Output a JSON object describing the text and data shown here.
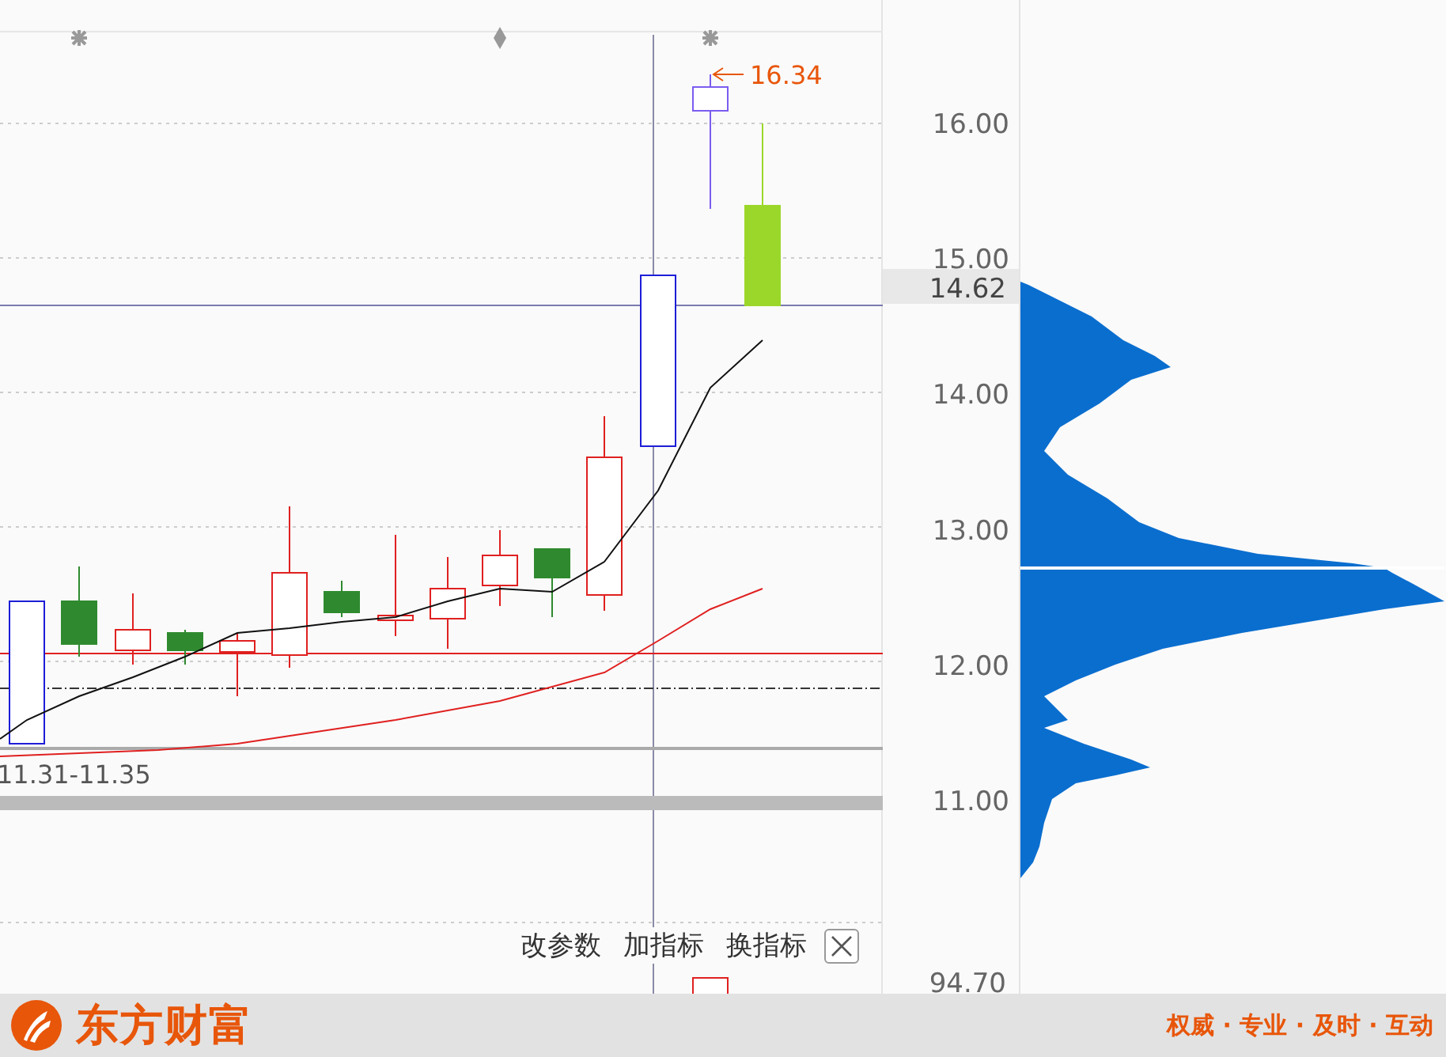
{
  "chart": {
    "high_label": "16.34",
    "range_label": "11.31-11.35"
  },
  "price_axis": {
    "labels": [
      "16.00",
      "15.00",
      "14.00",
      "13.00",
      "12.00",
      "11.00"
    ],
    "current_price": "14.62",
    "sub_label": "94.70"
  },
  "toolbar": {
    "buttons": [
      "改参数",
      "加指标",
      "换指标"
    ]
  },
  "footer": {
    "brand": "东方财富",
    "slogan": "权威 · 专业 · 及时 · 互动"
  }
}
